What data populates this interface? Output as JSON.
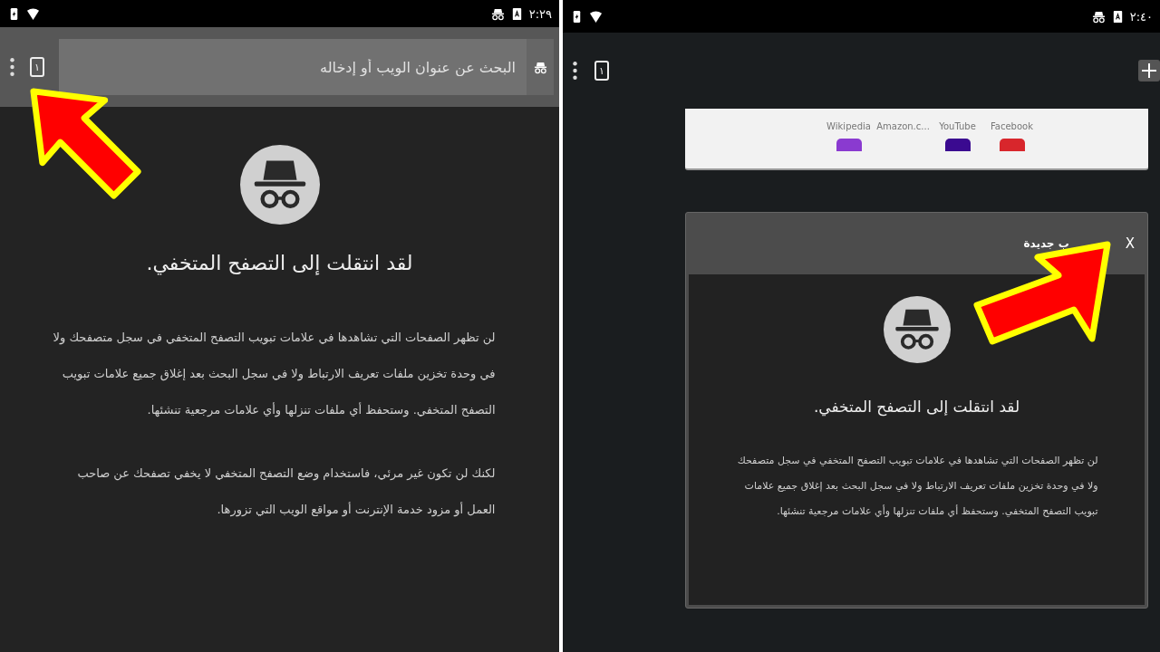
{
  "left_screen": {
    "status_bar": {
      "time": "٢:٢٩"
    },
    "toolbar": {
      "search": {
        "placeholder": "البحث عن عنوان الويب أو إدخاله"
      },
      "tab_count": "١"
    },
    "page": {
      "heading": "لقد انتقلت إلى التصفح المتخفي.",
      "paragraphs": [
        "لن تظهر الصفحات التي تشاهدها في علامات تبويب التصفح المتخفي في سجل متصفحك ولا في وحدة تخزين ملفات تعريف الارتباط ولا في سجل البحث بعد إغلاق جميع علامات تبويب التصفح المتخفي. وستحفظ أي ملفات تنزلها وأي علامات مرجعية تنشئها.",
        "لكنك لن تكون غير مرئي، فاستخدام وضع التصفح المتخفي لا يخفي تصفحك عن صاحب العمل أو مزود خدمة الإنترنت أو مواقع الويب التي تزورها."
      ]
    }
  },
  "right_screen": {
    "status_bar": {
      "time": "٢:٤٠"
    },
    "toolbar": {
      "tab_count": "١"
    },
    "shortcuts": [
      {
        "label": "Facebook"
      },
      {
        "label": "YouTube"
      },
      {
        "label": "Amazon.c..."
      },
      {
        "label": "Wikipedia"
      }
    ],
    "tab_card": {
      "title": "ب جديدة",
      "close": "X",
      "heading": "لقد انتقلت إلى التصفح المتخفي.",
      "paragraphs": [
        "لن تظهر الصفحات التي تشاهدها في علامات تبويب التصفح المتخفي في سجل متصفحك ولا في وحدة تخزين ملفات تعريف الارتباط ولا في سجل البحث بعد إغلاق جميع علامات تبويب التصفح المتخفي. وستحفظ أي ملفات تنزلها وأي علامات مرجعية تنشئها."
      ]
    }
  }
}
